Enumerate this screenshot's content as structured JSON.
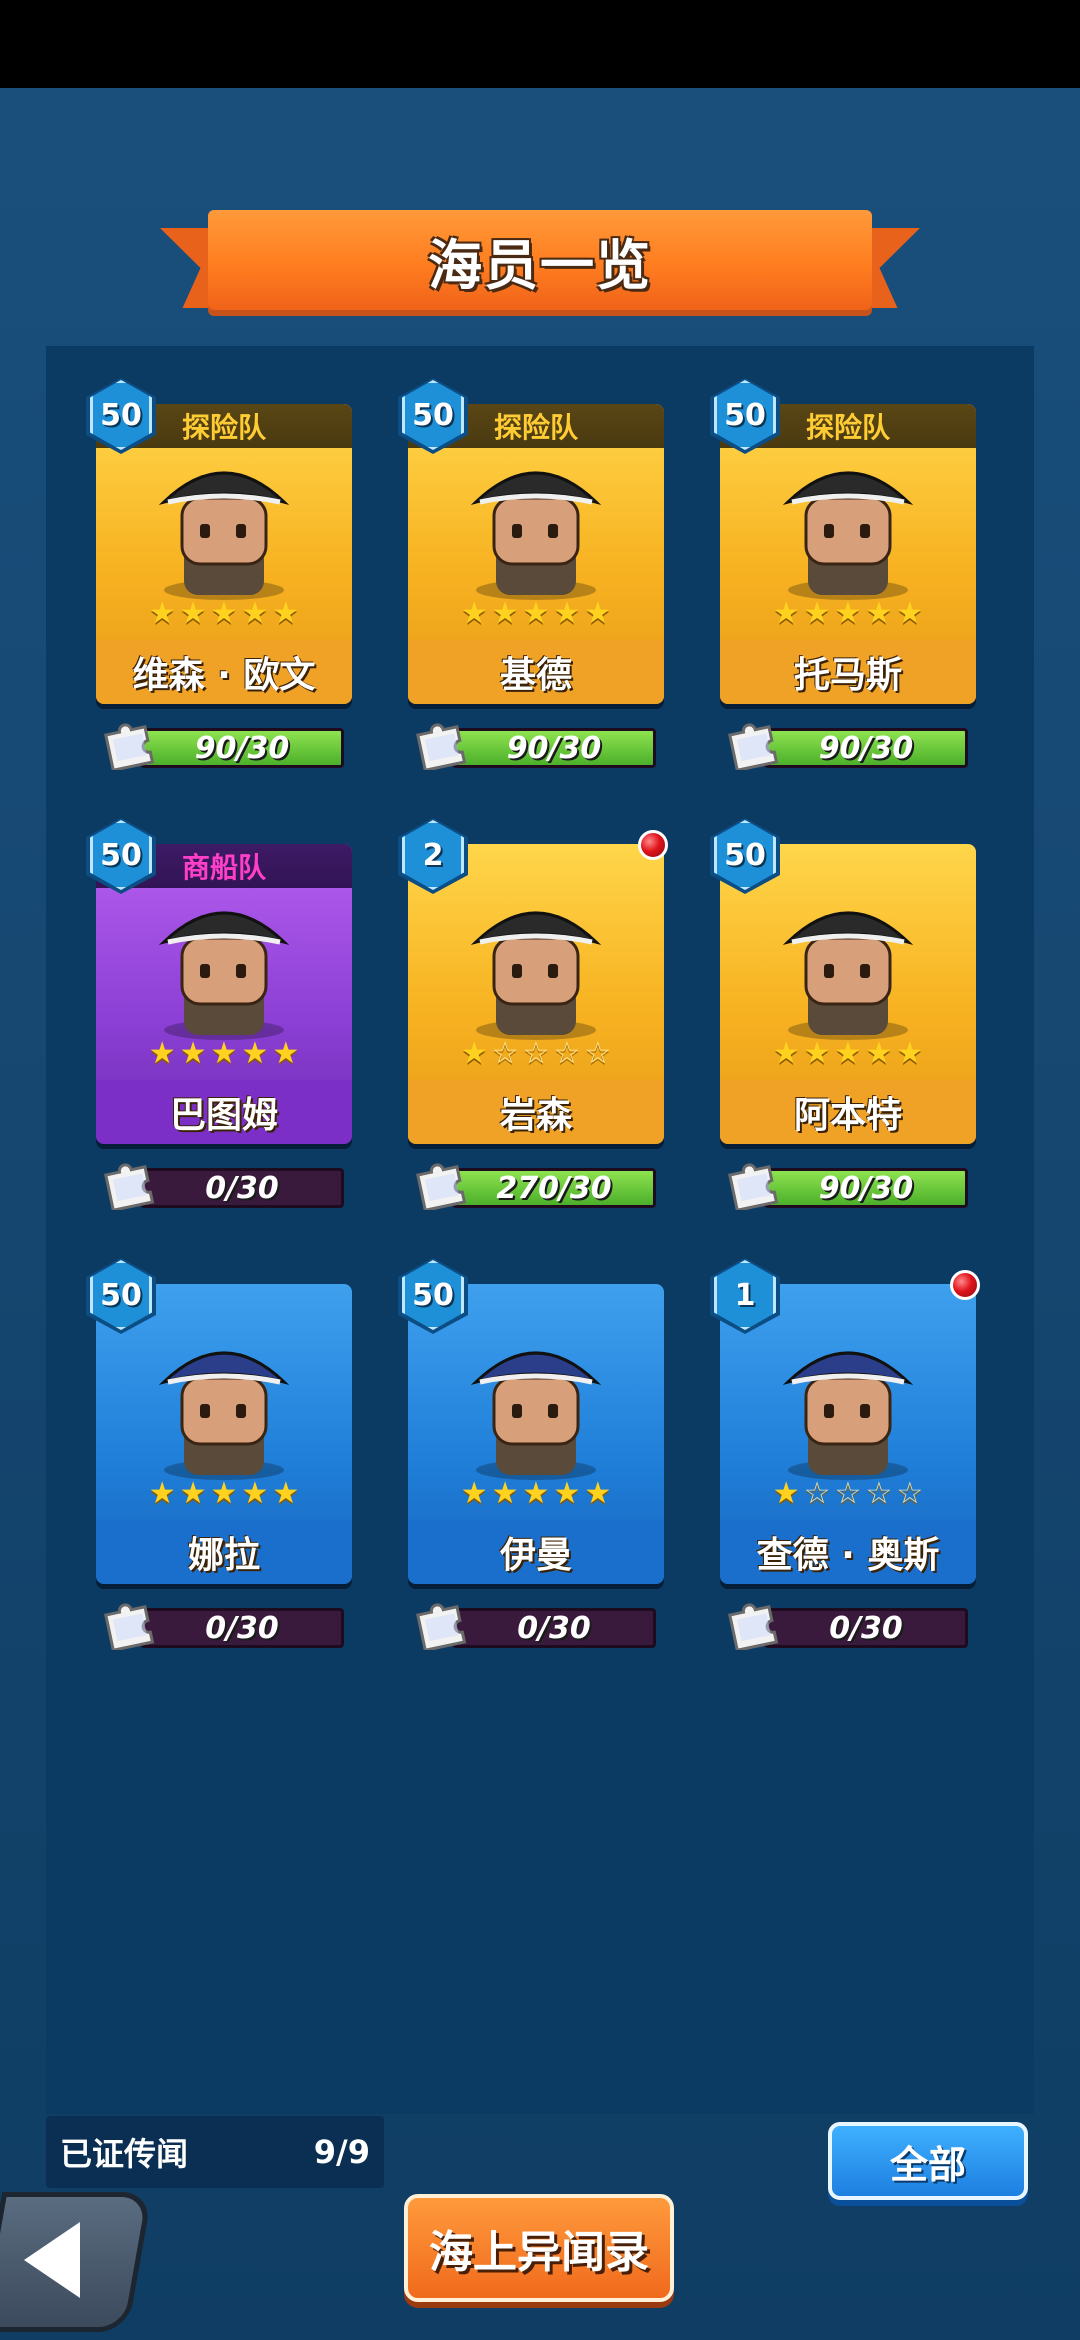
{
  "title": "海员一览",
  "crew": [
    {
      "level": "50",
      "team": "探险队",
      "team_type": "explore",
      "name": "维森 · 欧文",
      "stars": 5,
      "max_stars": 5,
      "progress_text": "90/30",
      "progress_fraction": 1.0,
      "color": "gold",
      "alert": false
    },
    {
      "level": "50",
      "team": "探险队",
      "team_type": "explore",
      "name": "基德",
      "stars": 5,
      "max_stars": 5,
      "progress_text": "90/30",
      "progress_fraction": 1.0,
      "color": "gold",
      "alert": false
    },
    {
      "level": "50",
      "team": "探险队",
      "team_type": "explore",
      "name": "托马斯",
      "stars": 5,
      "max_stars": 5,
      "progress_text": "90/30",
      "progress_fraction": 1.0,
      "color": "gold",
      "alert": false
    },
    {
      "level": "50",
      "team": "商船队",
      "team_type": "merchant",
      "name": "巴图姆",
      "stars": 5,
      "max_stars": 5,
      "progress_text": "0/30",
      "progress_fraction": 0,
      "color": "purple",
      "alert": false
    },
    {
      "level": "2",
      "team": "",
      "team_type": "",
      "name": "岩森",
      "stars": 1,
      "max_stars": 5,
      "progress_text": "270/30",
      "progress_fraction": 1.0,
      "color": "gold",
      "alert": true
    },
    {
      "level": "50",
      "team": "",
      "team_type": "",
      "name": "阿本特",
      "stars": 5,
      "max_stars": 5,
      "progress_text": "90/30",
      "progress_fraction": 1.0,
      "color": "gold",
      "alert": false
    },
    {
      "level": "50",
      "team": "",
      "team_type": "",
      "name": "娜拉",
      "stars": 5,
      "max_stars": 5,
      "progress_text": "0/30",
      "progress_fraction": 0,
      "color": "blue",
      "alert": false
    },
    {
      "level": "50",
      "team": "",
      "team_type": "",
      "name": "伊曼",
      "stars": 5,
      "max_stars": 5,
      "progress_text": "0/30",
      "progress_fraction": 0,
      "color": "blue",
      "alert": false
    },
    {
      "level": "1",
      "team": "",
      "team_type": "",
      "name": "查德 · 奥斯",
      "stars": 1,
      "max_stars": 5,
      "progress_text": "0/30",
      "progress_fraction": 0,
      "color": "blue",
      "alert": true
    }
  ],
  "footer": {
    "verified_label": "已证传闻",
    "verified_count": "9/9",
    "all_label": "全部",
    "journal_label": "海上异闻录"
  },
  "colors": {
    "background": "#164872",
    "banner": "#ff7d1f",
    "progress_fill": "#6cc93a",
    "progress_empty": "#3a1a3c"
  }
}
